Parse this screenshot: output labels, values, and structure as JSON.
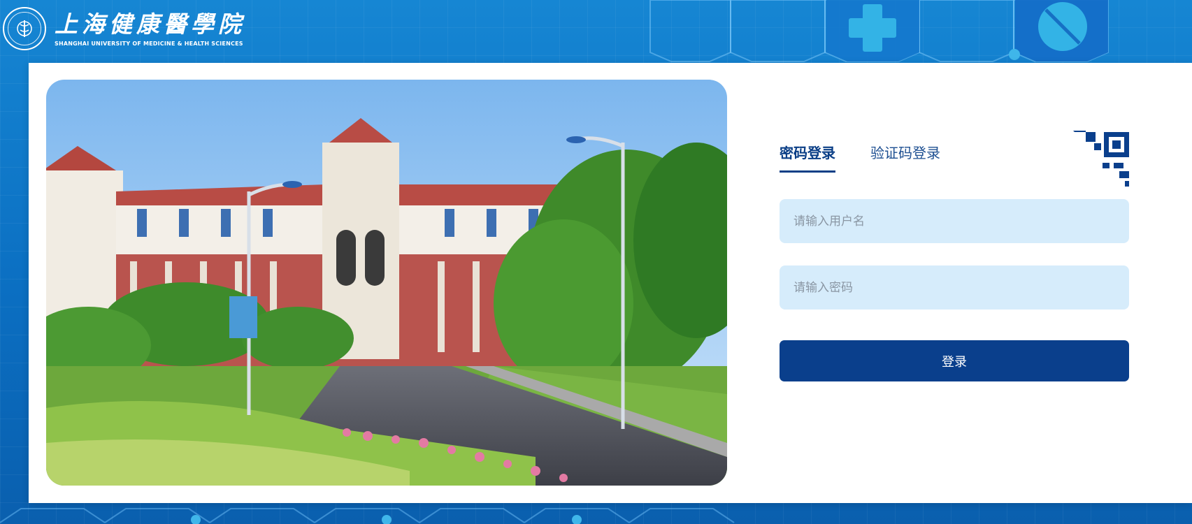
{
  "header": {
    "logo_cn": "上海健康醫學院",
    "logo_en": "SHANGHAI UNIVERSITY OF MEDICINE & HEALTH SCIENCES",
    "seal_icon": "university-seal-icon",
    "deco_icons": [
      "plus-hex-icon",
      "pill-hex-icon"
    ]
  },
  "photo": {
    "description_icon": "campus-photo"
  },
  "login": {
    "tabs": [
      {
        "label": "密码登录",
        "active": true
      },
      {
        "label": "验证码登录",
        "active": false
      }
    ],
    "qr_icon": "qr-code-corner-icon",
    "username": {
      "placeholder": "请输入用户名",
      "value": ""
    },
    "password": {
      "placeholder": "请输入密码",
      "value": ""
    },
    "submit_label": "登录"
  },
  "colors": {
    "brand_blue": "#0a3f8c",
    "input_bg": "#d6ecfb",
    "header_bg": "#1686d3"
  }
}
